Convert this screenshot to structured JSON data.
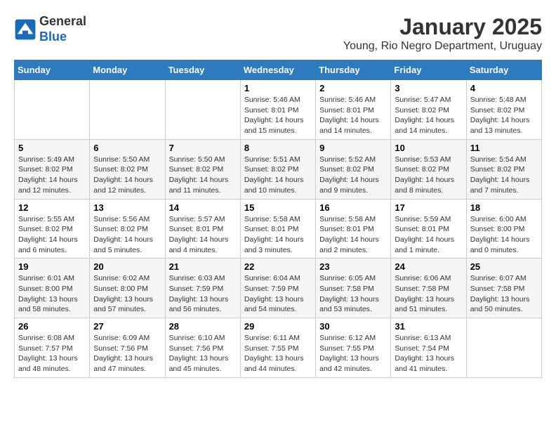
{
  "header": {
    "logo_line1": "General",
    "logo_line2": "Blue",
    "month": "January 2025",
    "location": "Young, Rio Negro Department, Uruguay"
  },
  "days_of_week": [
    "Sunday",
    "Monday",
    "Tuesday",
    "Wednesday",
    "Thursday",
    "Friday",
    "Saturday"
  ],
  "weeks": [
    [
      {
        "day": "",
        "info": ""
      },
      {
        "day": "",
        "info": ""
      },
      {
        "day": "",
        "info": ""
      },
      {
        "day": "1",
        "info": "Sunrise: 5:46 AM\nSunset: 8:01 PM\nDaylight: 14 hours\nand 15 minutes."
      },
      {
        "day": "2",
        "info": "Sunrise: 5:46 AM\nSunset: 8:01 PM\nDaylight: 14 hours\nand 14 minutes."
      },
      {
        "day": "3",
        "info": "Sunrise: 5:47 AM\nSunset: 8:02 PM\nDaylight: 14 hours\nand 14 minutes."
      },
      {
        "day": "4",
        "info": "Sunrise: 5:48 AM\nSunset: 8:02 PM\nDaylight: 14 hours\nand 13 minutes."
      }
    ],
    [
      {
        "day": "5",
        "info": "Sunrise: 5:49 AM\nSunset: 8:02 PM\nDaylight: 14 hours\nand 12 minutes."
      },
      {
        "day": "6",
        "info": "Sunrise: 5:50 AM\nSunset: 8:02 PM\nDaylight: 14 hours\nand 12 minutes."
      },
      {
        "day": "7",
        "info": "Sunrise: 5:50 AM\nSunset: 8:02 PM\nDaylight: 14 hours\nand 11 minutes."
      },
      {
        "day": "8",
        "info": "Sunrise: 5:51 AM\nSunset: 8:02 PM\nDaylight: 14 hours\nand 10 minutes."
      },
      {
        "day": "9",
        "info": "Sunrise: 5:52 AM\nSunset: 8:02 PM\nDaylight: 14 hours\nand 9 minutes."
      },
      {
        "day": "10",
        "info": "Sunrise: 5:53 AM\nSunset: 8:02 PM\nDaylight: 14 hours\nand 8 minutes."
      },
      {
        "day": "11",
        "info": "Sunrise: 5:54 AM\nSunset: 8:02 PM\nDaylight: 14 hours\nand 7 minutes."
      }
    ],
    [
      {
        "day": "12",
        "info": "Sunrise: 5:55 AM\nSunset: 8:02 PM\nDaylight: 14 hours\nand 6 minutes."
      },
      {
        "day": "13",
        "info": "Sunrise: 5:56 AM\nSunset: 8:02 PM\nDaylight: 14 hours\nand 5 minutes."
      },
      {
        "day": "14",
        "info": "Sunrise: 5:57 AM\nSunset: 8:01 PM\nDaylight: 14 hours\nand 4 minutes."
      },
      {
        "day": "15",
        "info": "Sunrise: 5:58 AM\nSunset: 8:01 PM\nDaylight: 14 hours\nand 3 minutes."
      },
      {
        "day": "16",
        "info": "Sunrise: 5:58 AM\nSunset: 8:01 PM\nDaylight: 14 hours\nand 2 minutes."
      },
      {
        "day": "17",
        "info": "Sunrise: 5:59 AM\nSunset: 8:01 PM\nDaylight: 14 hours\nand 1 minute."
      },
      {
        "day": "18",
        "info": "Sunrise: 6:00 AM\nSunset: 8:00 PM\nDaylight: 14 hours\nand 0 minutes."
      }
    ],
    [
      {
        "day": "19",
        "info": "Sunrise: 6:01 AM\nSunset: 8:00 PM\nDaylight: 13 hours\nand 58 minutes."
      },
      {
        "day": "20",
        "info": "Sunrise: 6:02 AM\nSunset: 8:00 PM\nDaylight: 13 hours\nand 57 minutes."
      },
      {
        "day": "21",
        "info": "Sunrise: 6:03 AM\nSunset: 7:59 PM\nDaylight: 13 hours\nand 56 minutes."
      },
      {
        "day": "22",
        "info": "Sunrise: 6:04 AM\nSunset: 7:59 PM\nDaylight: 13 hours\nand 54 minutes."
      },
      {
        "day": "23",
        "info": "Sunrise: 6:05 AM\nSunset: 7:58 PM\nDaylight: 13 hours\nand 53 minutes."
      },
      {
        "day": "24",
        "info": "Sunrise: 6:06 AM\nSunset: 7:58 PM\nDaylight: 13 hours\nand 51 minutes."
      },
      {
        "day": "25",
        "info": "Sunrise: 6:07 AM\nSunset: 7:58 PM\nDaylight: 13 hours\nand 50 minutes."
      }
    ],
    [
      {
        "day": "26",
        "info": "Sunrise: 6:08 AM\nSunset: 7:57 PM\nDaylight: 13 hours\nand 48 minutes."
      },
      {
        "day": "27",
        "info": "Sunrise: 6:09 AM\nSunset: 7:56 PM\nDaylight: 13 hours\nand 47 minutes."
      },
      {
        "day": "28",
        "info": "Sunrise: 6:10 AM\nSunset: 7:56 PM\nDaylight: 13 hours\nand 45 minutes."
      },
      {
        "day": "29",
        "info": "Sunrise: 6:11 AM\nSunset: 7:55 PM\nDaylight: 13 hours\nand 44 minutes."
      },
      {
        "day": "30",
        "info": "Sunrise: 6:12 AM\nSunset: 7:55 PM\nDaylight: 13 hours\nand 42 minutes."
      },
      {
        "day": "31",
        "info": "Sunrise: 6:13 AM\nSunset: 7:54 PM\nDaylight: 13 hours\nand 41 minutes."
      },
      {
        "day": "",
        "info": ""
      }
    ]
  ]
}
